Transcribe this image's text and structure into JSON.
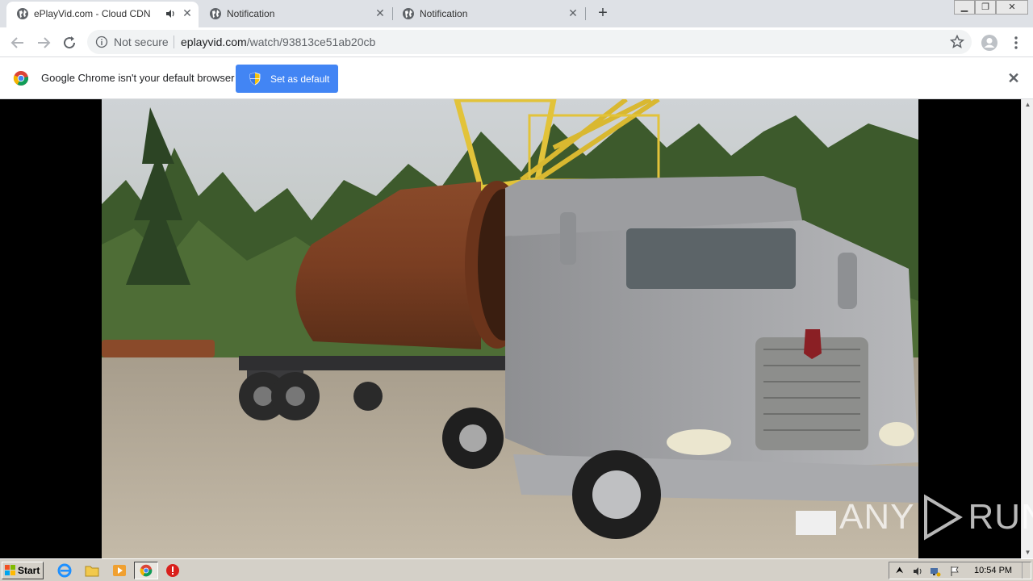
{
  "tabs": [
    {
      "title": "ePlayVid.com - Cloud CDN",
      "audio": true,
      "active": true
    },
    {
      "title": "Notification",
      "audio": false,
      "active": false
    },
    {
      "title": "Notification",
      "audio": false,
      "active": false
    }
  ],
  "omnibox": {
    "security_text": "Not secure",
    "url_host": "eplayvid.com",
    "url_path": "/watch/93813ce51ab20cb"
  },
  "infobar": {
    "message": "Google Chrome isn't your default browser",
    "button_label": "Set as default"
  },
  "watermark": {
    "text_left": "ANY",
    "text_right": "RUN"
  },
  "taskbar": {
    "start_label": "Start",
    "clock": "10:54 PM"
  },
  "colors": {
    "accent": "#4285f4",
    "tab_strip": "#dee1e6",
    "taskbar": "#d4d0c8"
  }
}
